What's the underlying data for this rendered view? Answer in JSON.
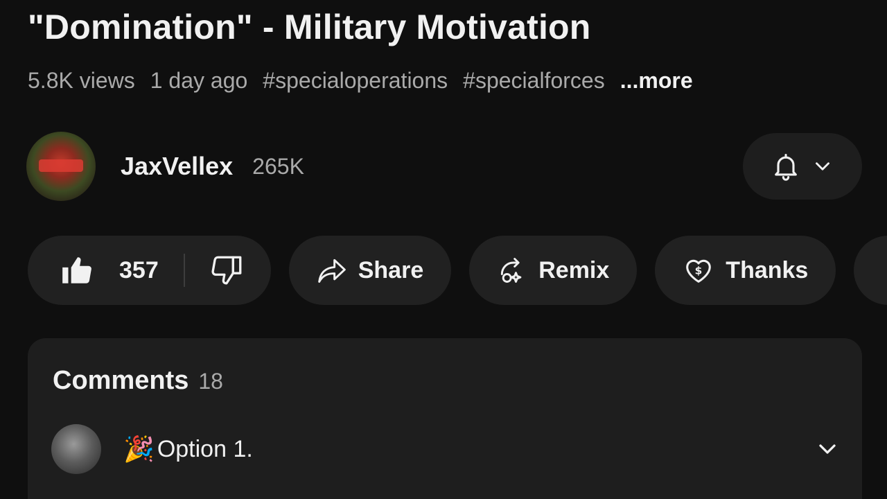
{
  "video": {
    "title": "\"Domination\" - Military Motivation",
    "views": "5.8K views",
    "age": "1 day ago",
    "hashtags": [
      "#specialoperations",
      "#specialforces"
    ],
    "more_label": "...more"
  },
  "channel": {
    "name": "JaxVellex",
    "subscribers": "265K",
    "bell_icon": "bell-icon",
    "dropdown_icon": "chevron-down-icon"
  },
  "actions": {
    "like_count": "357",
    "share_label": "Share",
    "remix_label": "Remix",
    "thanks_label": "Thanks"
  },
  "comments": {
    "title": "Comments",
    "count": "18",
    "preview": {
      "emoji": "🎉",
      "text": "Option 1."
    }
  },
  "colors": {
    "background": "#0f0f0f",
    "pill": "#212121",
    "panel": "#1e1e1e",
    "text_primary": "#f1f1f1",
    "text_secondary": "#aaaaaa"
  }
}
